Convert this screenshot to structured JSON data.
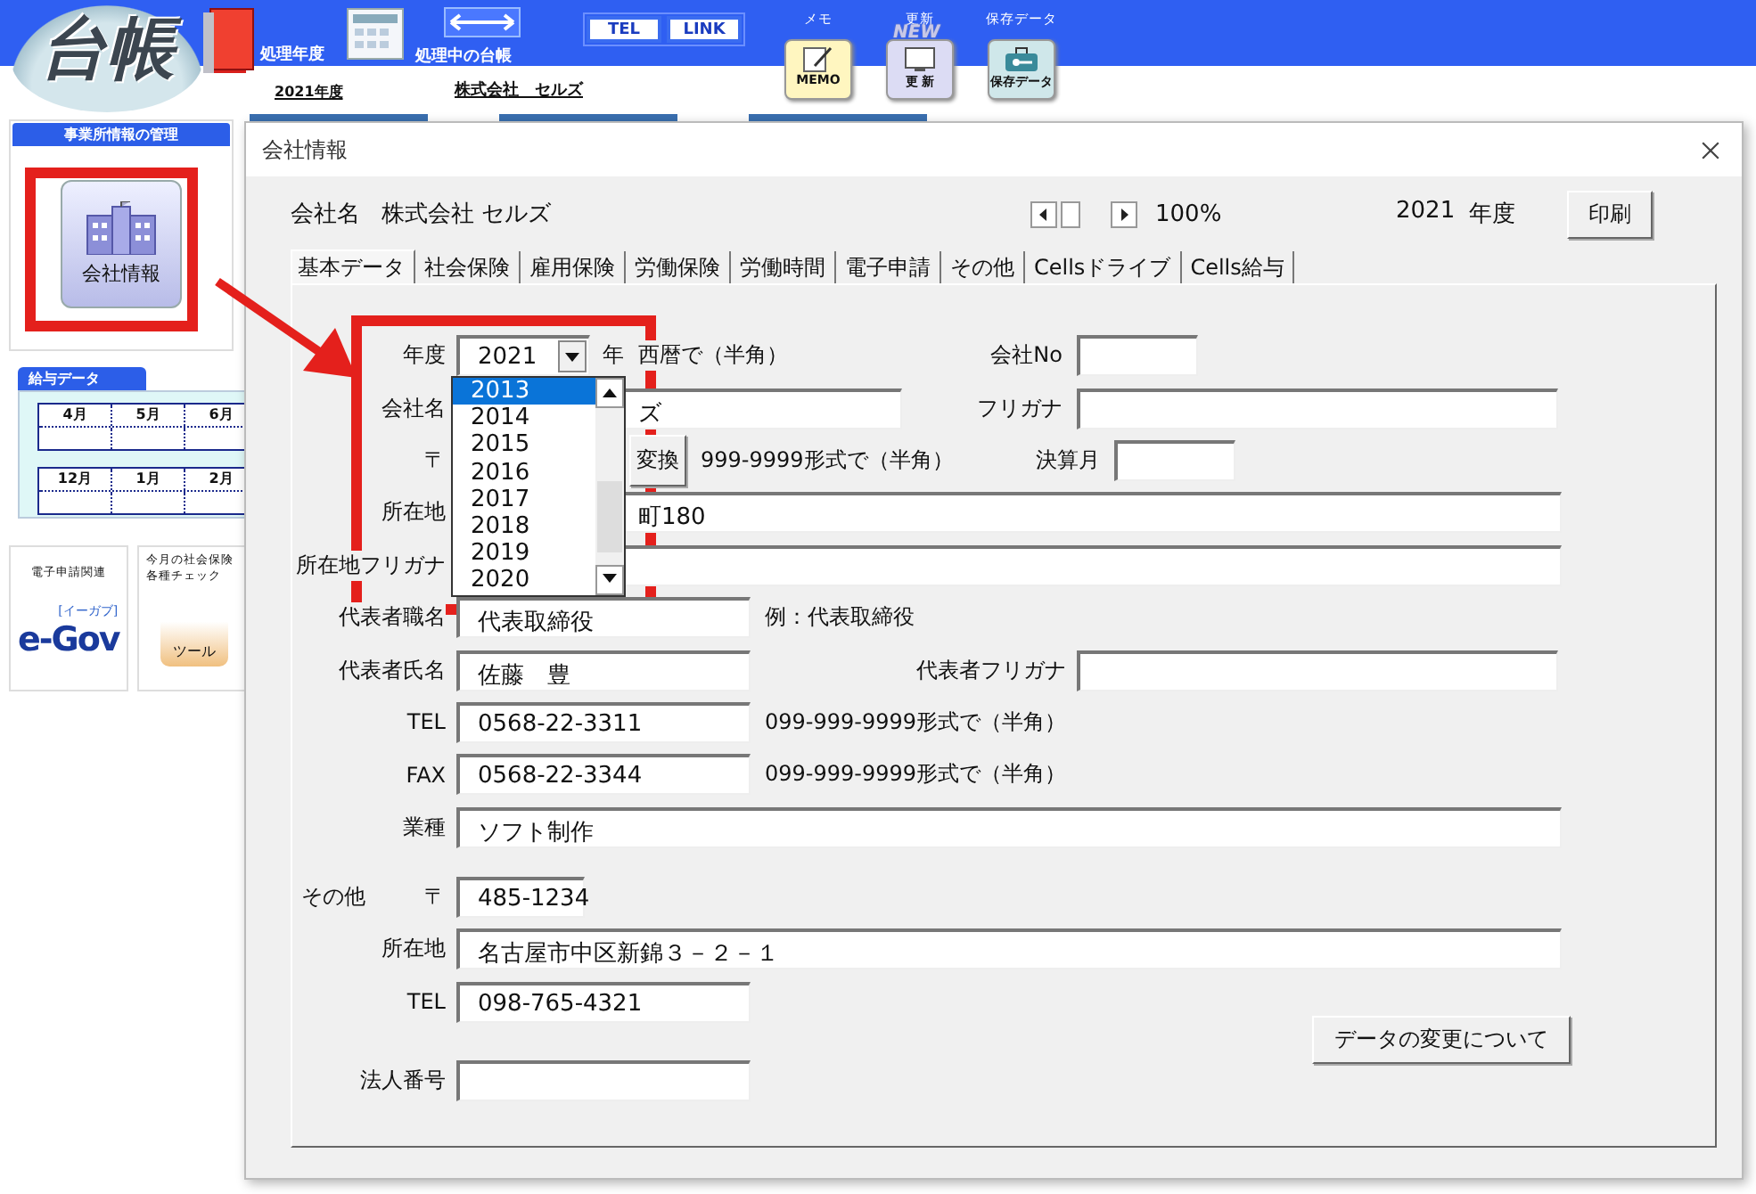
{
  "header": {
    "logo": "台帳",
    "year": {
      "label": "処理年度",
      "value": "2021年度"
    },
    "ledger": {
      "label": "処理中の台帳",
      "value": "株式会社　セルズ"
    },
    "buttons": [
      "TEL",
      "LINK"
    ],
    "tools": [
      {
        "kind": "memo",
        "label": "メモ",
        "caption": "MEMO"
      },
      {
        "kind": "update",
        "label": "更新",
        "badge": "NEW",
        "caption": "更 新"
      },
      {
        "kind": "save",
        "label": "保存データ",
        "caption": "保存データ"
      }
    ]
  },
  "sidebar": {
    "office": {
      "title": "事業所情報の管理",
      "button": "会社情報"
    },
    "salary": {
      "title": "給与データ",
      "rows": [
        [
          "4月",
          "5月",
          "6月"
        ],
        [
          "12月",
          "1月",
          "2月"
        ]
      ]
    },
    "cards": [
      {
        "kind": "egov",
        "title": "電子申請関連",
        "logo": "e-Gov",
        "logo_note": "[イーガブ]"
      },
      {
        "kind": "tool",
        "title": "今月の社会保険",
        "subtitle": "各種チェック",
        "caption": "ツール"
      }
    ]
  },
  "dialog": {
    "title": "会社情報",
    "company_label": "会社名",
    "company_name": "株式会社 セルズ",
    "zoom": "100%",
    "year": "2021",
    "year_unit": "年度",
    "print_button": "印刷",
    "tabs": [
      {
        "label": "基本データ",
        "selected": true
      },
      {
        "label": "社会保険",
        "selected": false
      },
      {
        "label": "雇用保険",
        "selected": false
      },
      {
        "label": "労働保険",
        "selected": false
      },
      {
        "label": "労働時間",
        "selected": false
      },
      {
        "label": "電子申請",
        "selected": false
      },
      {
        "label": "その他",
        "selected": false
      },
      {
        "label": "Cellsドライブ",
        "selected": false
      },
      {
        "label": "Cells給与",
        "selected": false
      }
    ],
    "form": {
      "rows": [
        {
          "kind": "combo",
          "label": "年度",
          "value": "2021",
          "unit": "年",
          "hint": "西暦で（半角）",
          "right": {
            "label": "会社No"
          }
        },
        {
          "kind": "text",
          "label": "会社名",
          "value": "ズ",
          "right": {
            "label": "フリガナ"
          }
        },
        {
          "kind": "text",
          "label": "〒",
          "button": "変換",
          "hint": "999-9999形式で（半角）",
          "right": {
            "label": "決算月"
          }
        },
        {
          "kind": "text",
          "label": "所在地",
          "value": "町180"
        },
        {
          "kind": "text",
          "label": "所在地フリガナ"
        },
        {
          "kind": "text",
          "label": "代表者職名",
          "value": "代表取締役",
          "hint": "例：代表取締役"
        },
        {
          "kind": "text",
          "label": "代表者氏名",
          "value": "佐藤　豊",
          "right": {
            "label": "代表者フリガナ"
          }
        },
        {
          "kind": "text",
          "label": "TEL",
          "value": "0568-22-3311",
          "hint": "099-999-9999形式で（半角）"
        },
        {
          "kind": "text",
          "label": "FAX",
          "value": "0568-22-3344",
          "hint": "099-999-9999形式で（半角）"
        },
        {
          "kind": "text",
          "label": "業種",
          "value": "ソフト制作"
        },
        {
          "kind": "text",
          "group": "その他",
          "label": "〒",
          "value": "485-1234"
        },
        {
          "kind": "text",
          "label": "所在地",
          "value": "名古屋市中区新錦３－２－１"
        },
        {
          "kind": "text",
          "label": "TEL",
          "value": "098-765-4321"
        },
        {
          "kind": "text",
          "label": "法人番号"
        }
      ],
      "year_list": [
        {
          "label": "2013",
          "selected": true
        },
        {
          "label": "2014",
          "selected": false
        },
        {
          "label": "2015",
          "selected": false
        },
        {
          "label": "2016",
          "selected": false
        },
        {
          "label": "2017",
          "selected": false
        },
        {
          "label": "2018",
          "selected": false
        },
        {
          "label": "2019",
          "selected": false
        },
        {
          "label": "2020",
          "selected": false
        }
      ]
    },
    "change_button": "データの変更について"
  }
}
